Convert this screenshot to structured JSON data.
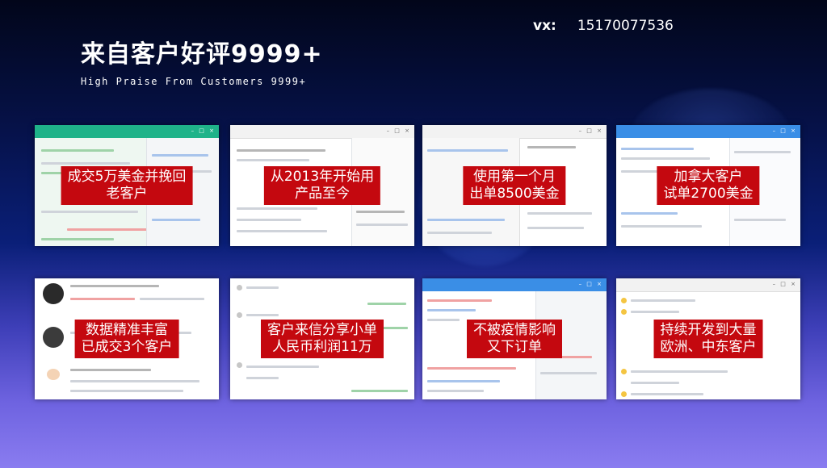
{
  "title": "来自客户好评9999+",
  "subtitle": "High Praise From Customers 9999+",
  "contact": {
    "label": "vx:",
    "number": "15170077536"
  },
  "colors": {
    "caption_bg": "#c4080f",
    "green_bar": "#1fb389",
    "blue_bar": "#3a8ee6"
  },
  "cards": [
    {
      "caption": [
        "成交5万美金并挽回",
        "老客户"
      ]
    },
    {
      "caption": [
        "从2013年开始用",
        "产品至今"
      ]
    },
    {
      "caption": [
        "使用第一个月",
        "出单8500美金"
      ]
    },
    {
      "caption": [
        "加拿大客户",
        "试单2700美金"
      ]
    },
    {
      "caption": [
        "数据精准丰富",
        "已成交3个客户"
      ]
    },
    {
      "caption": [
        "客户来信分享小单",
        "人民币利润11万"
      ]
    },
    {
      "caption": [
        "不被疫情影响",
        "又下订单"
      ]
    },
    {
      "caption": [
        "持续开发到大量",
        "欧洲、中东客户"
      ]
    }
  ]
}
